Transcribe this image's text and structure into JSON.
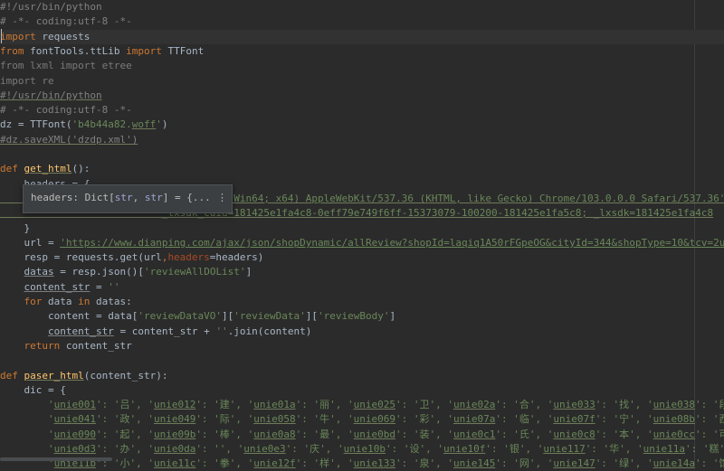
{
  "editor": {
    "lines": [
      [
        {
          "t": "#!/usr/bin/python",
          "c": "cmt"
        }
      ],
      [
        {
          "t": "# -*- coding:utf-8 -*-",
          "c": "cmt"
        }
      ],
      [
        {
          "t": "import",
          "c": "kw"
        },
        {
          "t": " requests"
        }
      ],
      [
        {
          "t": "from",
          "c": "kw"
        },
        {
          "t": " fontTools.ttLib "
        },
        {
          "t": "import",
          "c": "kw"
        },
        {
          "t": " TTFont"
        }
      ],
      [
        {
          "t": "from lxml import etree",
          "c": "unused"
        }
      ],
      [
        {
          "t": "import re",
          "c": "unused"
        }
      ],
      [
        {
          "t": "#!/usr/bin/python",
          "c": "cmt ul"
        }
      ],
      [
        {
          "t": "# -*- coding:utf-8 -*-",
          "c": "cmt"
        }
      ],
      [
        {
          "t": "dz = TTFont("
        },
        {
          "t": "'b4b44a82.",
          "c": "str"
        },
        {
          "t": "woff",
          "c": "str ul"
        },
        {
          "t": "'",
          "c": "str"
        },
        {
          "t": ")"
        }
      ],
      [
        {
          "t": "#dz.saveXML('dzdp.xml')",
          "c": "cmt ul"
        }
      ],
      [
        {
          "t": ""
        }
      ],
      [
        {
          "t": "def",
          "c": "kw"
        },
        {
          "t": " "
        },
        {
          "t": "get_html",
          "c": "fn ul"
        },
        {
          "t": "():"
        }
      ],
      [
        {
          "t": "    headers = {"
        }
      ],
      [
        {
          "t": "                           ws NT 10.0; Win64; x64) AppleWebKit/537.36 (KHTML, like Gecko) Chrome/103.0.0.0 Safari/537.36'",
          "c": "str ul"
        }
      ],
      [
        {
          "t": "                           _lxsdk_cuid=181425e1fa4c8-0eff79e749f6ff-15373079-100200-181425e1fa5c8; _lxsdk=181425e1fa4c8",
          "c": "str ul"
        }
      ],
      [
        {
          "t": "    }"
        }
      ],
      [
        {
          "t": "    url = "
        },
        {
          "t": "'https://www.dianping.com/ajax/json/shopDynamic/allReview?shopId=laqiq1A50rFGpeOG&cityId=344&shopType=10&tcv=2udm55o5oc&",
          "c": "str link"
        }
      ],
      [
        {
          "t": "    resp = requests.get(url"
        },
        {
          "t": ",",
          "c": "kw"
        },
        {
          "t": "headers",
          "c": "kwarg"
        },
        {
          "t": "=headers)"
        }
      ],
      [
        {
          "t": "    "
        },
        {
          "t": "datas",
          "c": "ulw"
        },
        {
          "t": " = resp.json()["
        },
        {
          "t": "'reviewAllDOList'",
          "c": "str"
        },
        {
          "t": "]"
        }
      ],
      [
        {
          "t": "    "
        },
        {
          "t": "content_str",
          "c": "ulw"
        },
        {
          "t": " = "
        },
        {
          "t": "''",
          "c": "str"
        }
      ],
      [
        {
          "t": "    "
        },
        {
          "t": "for",
          "c": "kw"
        },
        {
          "t": " data "
        },
        {
          "t": "in",
          "c": "kw"
        },
        {
          "t": " datas:"
        }
      ],
      [
        {
          "t": "        content = data["
        },
        {
          "t": "'reviewDataVO'",
          "c": "str"
        },
        {
          "t": "]["
        },
        {
          "t": "'reviewData'",
          "c": "str"
        },
        {
          "t": "]["
        },
        {
          "t": "'reviewBody'",
          "c": "str"
        },
        {
          "t": "]"
        }
      ],
      [
        {
          "t": "        "
        },
        {
          "t": "content_str",
          "c": "ulw"
        },
        {
          "t": " = content_str + "
        },
        {
          "t": "''",
          "c": "str"
        },
        {
          "t": ".join(content)"
        }
      ],
      [
        {
          "t": "    "
        },
        {
          "t": "return",
          "c": "kw"
        },
        {
          "t": " content_str"
        }
      ],
      [
        {
          "t": ""
        }
      ],
      [
        {
          "t": "def",
          "c": "kw"
        },
        {
          "t": " "
        },
        {
          "t": "paser_html",
          "c": "fn ul"
        },
        {
          "t": "(content_str):"
        }
      ],
      [
        {
          "t": "    dic = {"
        }
      ],
      [
        {
          "t": "        '",
          "c": "str"
        },
        {
          "t": "unie001",
          "c": "str ul"
        },
        {
          "t": "': '吕', '",
          "c": "str"
        },
        {
          "t": "unie012",
          "c": "str ul"
        },
        {
          "t": "': '建', '",
          "c": "str"
        },
        {
          "t": "unie01a",
          "c": "str ul"
        },
        {
          "t": "': '丽', '",
          "c": "str"
        },
        {
          "t": "unie025",
          "c": "str ul"
        },
        {
          "t": "': '卫', '",
          "c": "str"
        },
        {
          "t": "unie02a",
          "c": "str ul"
        },
        {
          "t": "': '合', '",
          "c": "str"
        },
        {
          "t": "unie033",
          "c": "str ul"
        },
        {
          "t": "': '找', '",
          "c": "str"
        },
        {
          "t": "unie038",
          "c": "str ul"
        },
        {
          "t": "': '段',",
          "c": "str"
        }
      ],
      [
        {
          "t": "        '",
          "c": "str"
        },
        {
          "t": "unie041",
          "c": "str ul"
        },
        {
          "t": "': '政', '",
          "c": "str"
        },
        {
          "t": "unie049",
          "c": "str ul"
        },
        {
          "t": "': '际', '",
          "c": "str"
        },
        {
          "t": "unie058",
          "c": "str ul"
        },
        {
          "t": "': '牛', '",
          "c": "str"
        },
        {
          "t": "unie069",
          "c": "str ul"
        },
        {
          "t": "': '彩', '",
          "c": "str"
        },
        {
          "t": "unie07a",
          "c": "str ul"
        },
        {
          "t": "': '临', '",
          "c": "str"
        },
        {
          "t": "unie07f",
          "c": "str ul"
        },
        {
          "t": "': '宁', '",
          "c": "str"
        },
        {
          "t": "unie08b",
          "c": "str ul"
        },
        {
          "t": "': '西',",
          "c": "str"
        }
      ],
      [
        {
          "t": "        '",
          "c": "str"
        },
        {
          "t": "unie090",
          "c": "str ul"
        },
        {
          "t": "': '起', '",
          "c": "str"
        },
        {
          "t": "unie09b",
          "c": "str ul"
        },
        {
          "t": "': '棒', '",
          "c": "str"
        },
        {
          "t": "unie0a8",
          "c": "str ul"
        },
        {
          "t": "': '最', '",
          "c": "str"
        },
        {
          "t": "unie0bd",
          "c": "str ul"
        },
        {
          "t": "': '装', '",
          "c": "str"
        },
        {
          "t": "unie0c1",
          "c": "str ul"
        },
        {
          "t": "': '氏', '",
          "c": "str"
        },
        {
          "t": "unie0c8",
          "c": "str ul"
        },
        {
          "t": "': '本', '",
          "c": "str"
        },
        {
          "t": "unie0cc",
          "c": "str ul"
        },
        {
          "t": "': '可',",
          "c": "str"
        }
      ],
      [
        {
          "t": "        '",
          "c": "str"
        },
        {
          "t": "unie0d3",
          "c": "str ul"
        },
        {
          "t": "': '办', '",
          "c": "str"
        },
        {
          "t": "unie0da",
          "c": "str ul"
        },
        {
          "t": "': '', '",
          "c": "str"
        },
        {
          "t": "unie0e3",
          "c": "str ul"
        },
        {
          "t": "': '庆', '",
          "c": "str"
        },
        {
          "t": "unie10b",
          "c": "str ul"
        },
        {
          "t": "': '设', '",
          "c": "str"
        },
        {
          "t": "unie10f",
          "c": "str ul"
        },
        {
          "t": "': '银', '",
          "c": "str"
        },
        {
          "t": "unie117",
          "c": "str ul"
        },
        {
          "t": "': '华', '",
          "c": "str"
        },
        {
          "t": "unie11a",
          "c": "str ul"
        },
        {
          "t": "': '糕',",
          "c": "str"
        }
      ],
      [
        {
          "t": "        '",
          "c": "str"
        },
        {
          "t": "unie11b",
          "c": "str ul"
        },
        {
          "t": "': '小', '",
          "c": "str"
        },
        {
          "t": "unie11c",
          "c": "str ul"
        },
        {
          "t": "': '拳', '",
          "c": "str"
        },
        {
          "t": "unie12f",
          "c": "str ul"
        },
        {
          "t": "': '样', '",
          "c": "str"
        },
        {
          "t": "unie133",
          "c": "str ul"
        },
        {
          "t": "': '泉', '",
          "c": "str"
        },
        {
          "t": "unie145",
          "c": "str ul"
        },
        {
          "t": "': '网', '",
          "c": "str"
        },
        {
          "t": "unie147",
          "c": "str ul"
        },
        {
          "t": "': '绿', '",
          "c": "str"
        },
        {
          "t": "unie14a",
          "c": "str ul"
        },
        {
          "t": "': '馆',",
          "c": "str"
        }
      ]
    ]
  },
  "tooltip": {
    "text_prefix": "headers: Dict[",
    "type1": "str",
    "sep": ", ",
    "type2": "str",
    "text_suffix": "] = {...",
    "more_label": "⋮"
  }
}
